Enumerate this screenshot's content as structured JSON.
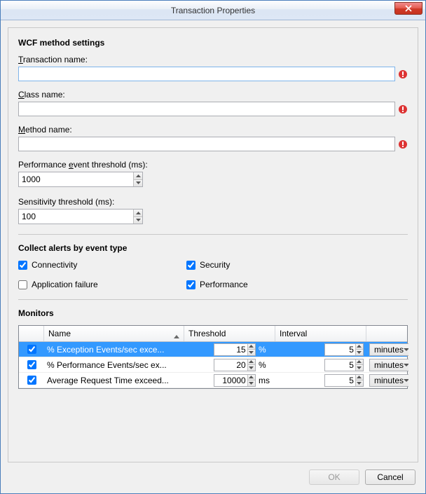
{
  "window": {
    "title": "Transaction Properties"
  },
  "section_wcf": {
    "heading": "WCF method settings",
    "transaction_name_label": "Transaction name:",
    "transaction_name_value": "",
    "class_name_label": "Class name:",
    "class_name_value": "",
    "method_name_label": "Method name:",
    "method_name_value": "",
    "perf_threshold_label": "Performance event threshold (ms):",
    "perf_threshold_value": "1000",
    "sensitivity_label": "Sensitivity threshold (ms):",
    "sensitivity_value": "100"
  },
  "section_alerts": {
    "heading": "Collect alerts by event type",
    "connectivity": {
      "label": "Connectivity",
      "checked": true
    },
    "security": {
      "label": "Security",
      "checked": true
    },
    "app_failure": {
      "label": "Application failure",
      "checked": false
    },
    "performance": {
      "label": "Performance",
      "checked": true
    }
  },
  "section_monitors": {
    "heading": "Monitors",
    "columns": {
      "name": "Name",
      "threshold": "Threshold",
      "interval": "Interval"
    },
    "rows": [
      {
        "checked": true,
        "name": "% Exception Events/sec exce...",
        "threshold": "15",
        "threshold_unit": "%",
        "interval": "5",
        "interval_unit": "minutes",
        "selected": true
      },
      {
        "checked": true,
        "name": "% Performance Events/sec ex...",
        "threshold": "20",
        "threshold_unit": "%",
        "interval": "5",
        "interval_unit": "minutes",
        "selected": false
      },
      {
        "checked": true,
        "name": "Average Request Time exceed...",
        "threshold": "10000",
        "threshold_unit": "ms",
        "interval": "5",
        "interval_unit": "minutes",
        "selected": false
      }
    ]
  },
  "buttons": {
    "ok": "OK",
    "cancel": "Cancel"
  }
}
